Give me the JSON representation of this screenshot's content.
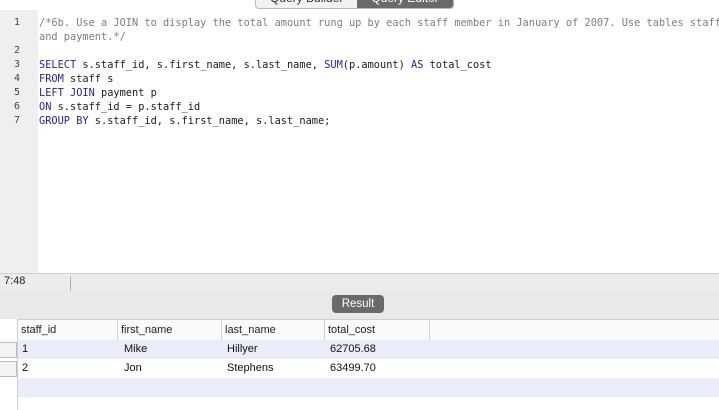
{
  "mode_tabs": [
    "Query Builder",
    "Query Editor"
  ],
  "editor": {
    "lines": [
      {
        "n": "1",
        "kind": "comment",
        "text": "/*6b. Use a JOIN to display the total amount rung up by each staff member in January of 2007. Use tables staff"
      },
      {
        "n": "",
        "kind": "comment",
        "text": "and payment.*/"
      },
      {
        "n": "2",
        "kind": "blank",
        "text": ""
      },
      {
        "n": "3",
        "kind": "select",
        "text": "SELECT s.staff_id, s.first_name, s.last_name, SUM(p.amount) AS total_cost"
      },
      {
        "n": "4",
        "kind": "from",
        "text": "FROM staff s"
      },
      {
        "n": "5",
        "kind": "join",
        "text": "LEFT JOIN payment p"
      },
      {
        "n": "6",
        "kind": "on",
        "text": "ON s.staff_id = p.staff_id"
      },
      {
        "n": "7",
        "kind": "group",
        "text": "GROUP BY s.staff_id, s.first_name, s.last_name;"
      }
    ]
  },
  "status": {
    "cursor": "7:48"
  },
  "result_button": "Result",
  "grid": {
    "columns": [
      "staff_id",
      "first_name",
      "last_name",
      "total_cost"
    ],
    "rows": [
      [
        "1",
        "Mike",
        "Hillyer",
        "62705.68"
      ],
      [
        "2",
        "Jon",
        "Stephens",
        "63499.70"
      ]
    ]
  }
}
